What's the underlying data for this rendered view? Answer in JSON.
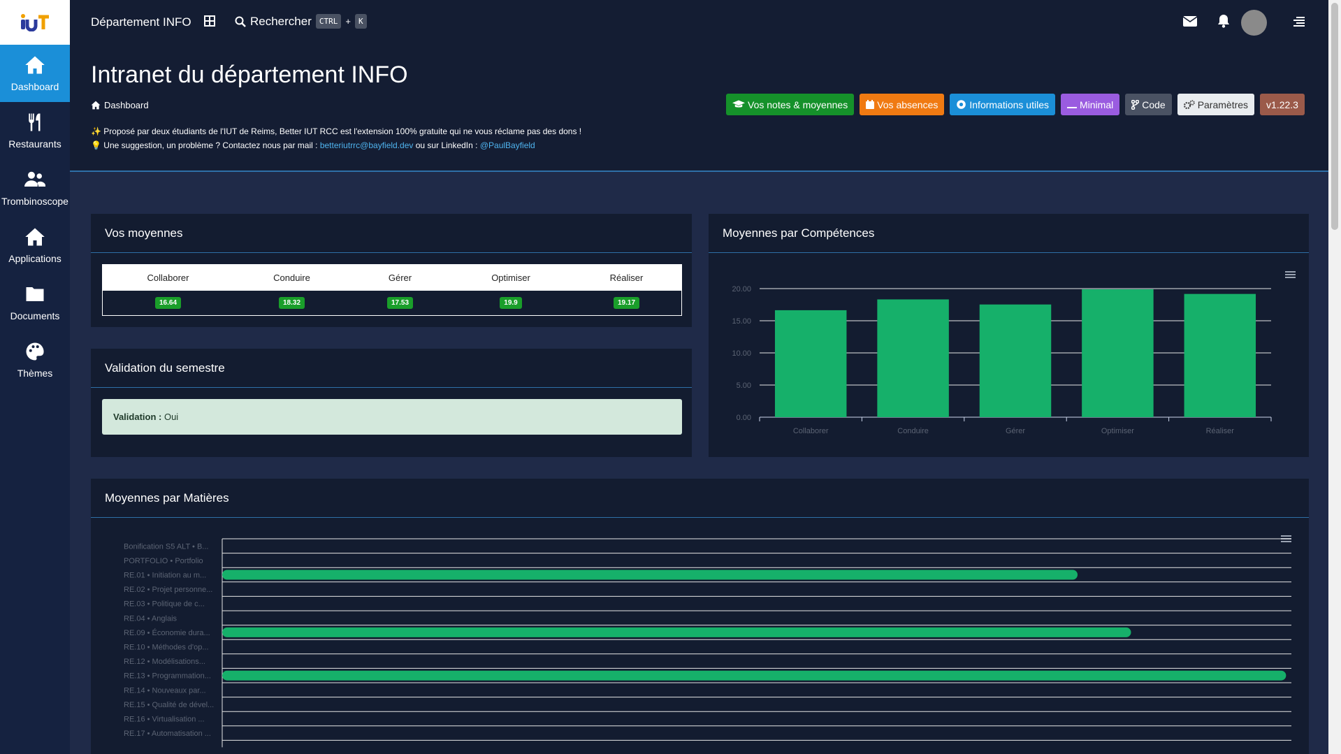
{
  "sidebar": {
    "logo": "IUT",
    "items": [
      {
        "label": "Dashboard",
        "icon": "home-icon"
      },
      {
        "label": "Restaurants",
        "icon": "fork-knife-icon"
      },
      {
        "label": "Trombinoscope",
        "icon": "users-icon"
      },
      {
        "label": "Applications",
        "icon": "home-icon"
      },
      {
        "label": "Documents",
        "icon": "folder-icon"
      },
      {
        "label": "Thèmes",
        "icon": "palette-icon"
      }
    ]
  },
  "topbar": {
    "title": "Département INFO",
    "search_label": "Rechercher",
    "kbd_ctrl": "CTRL",
    "kbd_plus": "+",
    "kbd_k": "K"
  },
  "page": {
    "title": "Intranet du département INFO",
    "breadcrumb": "Dashboard",
    "info_line1": "Proposé par deux étudiants de l'IUT de Reims, Better IUT RCC est l'extension 100% gratuite qui ne vous réclame pas des dons !",
    "info_line2_prefix": "Une suggestion, un problème ? Contactez nous par mail :",
    "info_email": "betteriutrrc@bayfield.dev",
    "info_line2_mid": "ou sur LinkedIn :",
    "info_linkedin": "@PaulBayfield"
  },
  "buttons": [
    {
      "label": "Vos notes & moyennes",
      "color": "#15912a",
      "icon": "graduation-icon"
    },
    {
      "label": "Vos absences",
      "color": "#f07a12",
      "icon": "calendar-icon"
    },
    {
      "label": "Informations utiles",
      "color": "#1b8fd8",
      "icon": "eye-icon"
    },
    {
      "label": "Minimal",
      "color": "#9a5ce0",
      "icon": "minimal-icon"
    },
    {
      "label": "Code",
      "color": "#4a5263",
      "icon": "code-branch-icon"
    },
    {
      "label": "Paramètres",
      "color": "#e9ecef",
      "icon": "gears-icon"
    },
    {
      "label": "v1.22.3",
      "color": "#9b5a4a",
      "icon": ""
    }
  ],
  "moyennes": {
    "title": "Vos moyennes",
    "headers": [
      "Collaborer",
      "Conduire",
      "Gérer",
      "Optimiser",
      "Réaliser"
    ],
    "values": [
      "16.64",
      "18.32",
      "17.53",
      "19.9",
      "19.17"
    ]
  },
  "validation": {
    "title": "Validation du semestre",
    "label": "Validation :",
    "value": "Oui"
  },
  "competences": {
    "title": "Moyennes par Compétences"
  },
  "matieres": {
    "title": "Moyennes par Matières"
  },
  "chart_data": [
    {
      "type": "bar",
      "categories": [
        "Collaborer",
        "Conduire",
        "Gérer",
        "Optimiser",
        "Réaliser"
      ],
      "values": [
        16.64,
        18.32,
        17.53,
        19.9,
        19.17
      ],
      "yticks": [
        "0.00",
        "5.00",
        "10.00",
        "15.00",
        "20.00"
      ],
      "ylim": [
        0,
        20
      ],
      "color": "#16b06a",
      "grid": true
    },
    {
      "type": "bar",
      "orientation": "horizontal",
      "categories": [
        "Bonification S5 ALT • B...",
        "PORTFOLIO • Portfolio",
        "RE.01 • Initiation au m...",
        "RE.02 • Projet personne...",
        "RE.03 • Politique de c...",
        "RE.04 • Anglais",
        "RE.09 • Économie dura...",
        "RE.10 • Méthodes d'op...",
        "RE.12 • Modélisations...",
        "RE.13 • Programmation...",
        "RE.14 • Nouveaux par...",
        "RE.15 • Qualité de dével...",
        "RE.16 • Virtualisation ...",
        "RE.17 • Automatisation ..."
      ],
      "values": [
        0,
        0,
        16,
        0,
        0,
        0,
        17,
        0,
        0,
        19.9,
        0,
        0,
        0,
        0
      ],
      "xlim": [
        0,
        20
      ],
      "color": "#16b06a",
      "grid": true
    }
  ]
}
